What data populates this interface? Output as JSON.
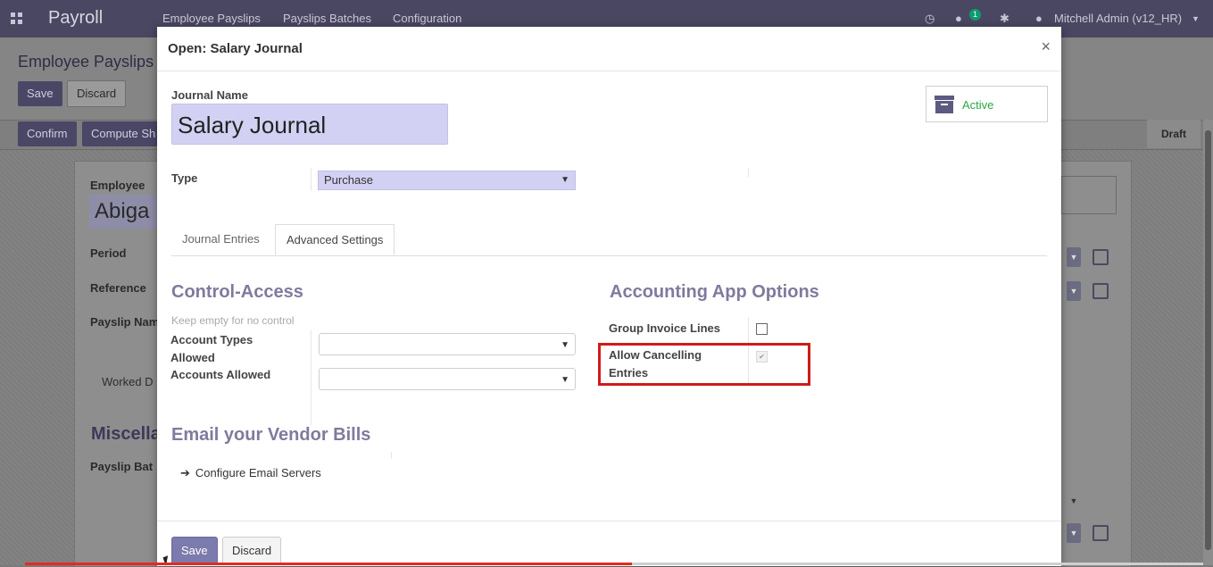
{
  "navbar": {
    "brand": "Payroll",
    "menu": [
      "Employee Payslips",
      "Payslips Batches",
      "Configuration"
    ],
    "chat_count": "1",
    "user": "Mitchell Admin (v12_HR)"
  },
  "background": {
    "breadcrumb_title": "Employee Payslips",
    "save_label": "Save",
    "discard_label": "Discard",
    "confirm_label": "Confirm",
    "compute_label": "Compute Sh",
    "status_draft": "Draft",
    "employee_label": "Employee",
    "employee_value": "Abiga",
    "period_label": "Period",
    "reference_label": "Reference",
    "payslip_name_label": "Payslip Nam",
    "worked_tab": "Worked D",
    "misc_title": "Miscella",
    "payslip_batch_label": "Payslip Bat"
  },
  "modal": {
    "title": "Open: Salary Journal",
    "journal_name_label": "Journal Name",
    "journal_name_value": "Salary Journal",
    "status": "Active",
    "type_label": "Type",
    "type_value": "Purchase",
    "tabs": [
      {
        "label": "Journal Entries"
      },
      {
        "label": "Advanced Settings"
      }
    ],
    "control_access": {
      "title": "Control-Access",
      "hint": "Keep empty for no control",
      "account_types_label_1": "Account Types",
      "account_types_label_2": "Allowed",
      "accounts_allowed_label": "Accounts Allowed"
    },
    "accounting_options": {
      "title": "Accounting App Options",
      "group_invoice_lines_label": "Group Invoice Lines",
      "allow_cancelling_label_1": "Allow Cancelling",
      "allow_cancelling_label_2": "Entries"
    },
    "email_section": {
      "title": "Email your Vendor Bills",
      "configure_link": "Configure Email Servers"
    },
    "footer": {
      "save_label": "Save",
      "discard_label": "Discard"
    }
  }
}
